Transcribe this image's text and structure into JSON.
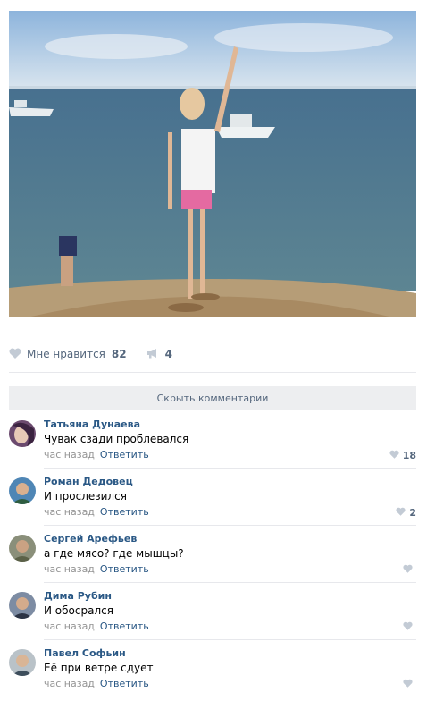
{
  "post": {
    "likes_label": "Мне нравится",
    "likes_count": "82",
    "shares_count": "4"
  },
  "comments_toggle_label": "Скрыть комментарии",
  "comments": [
    {
      "author": "Татьяна Дунаева",
      "text": "Чувак сзади проблевался",
      "time": "час назад",
      "reply": "Ответить",
      "likes": "18"
    },
    {
      "author": "Роман Дедовец",
      "text": "И прослезился",
      "time": "час назад",
      "reply": "Ответить",
      "likes": "2"
    },
    {
      "author": "Сергей Арефьев",
      "text": "а где мясо? где мышцы?",
      "time": "час назад",
      "reply": "Ответить",
      "likes": ""
    },
    {
      "author": "Дима Рубин",
      "text": "И обосрался",
      "time": "час назад",
      "reply": "Ответить",
      "likes": ""
    },
    {
      "author": "Павел Софьин",
      "text": "Её при ветре сдует",
      "time": "час назад",
      "reply": "Ответить",
      "likes": ""
    }
  ],
  "colors": {
    "link": "#2a5885",
    "muted": "#55677d",
    "bar": "#edeef0"
  }
}
